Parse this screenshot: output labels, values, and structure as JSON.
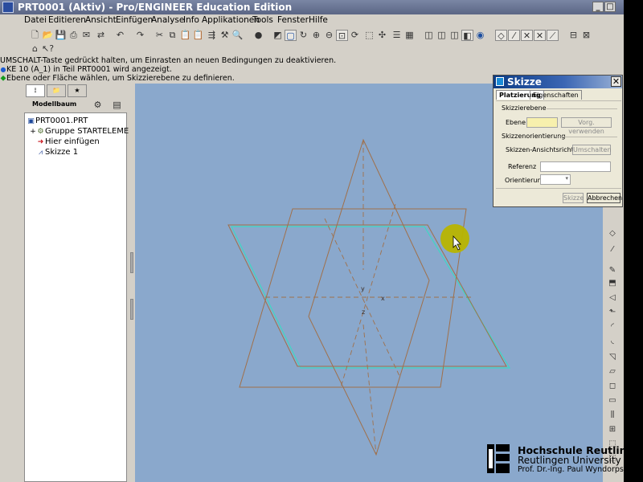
{
  "window": {
    "title": "PRT0001 (Aktiv) - Pro/ENGINEER Education Edition",
    "minimize_glyph": "_",
    "maximize_glyph": "□",
    "close_glyph": "✕"
  },
  "menu": [
    "Datei",
    "Editieren",
    "Ansicht",
    "Einfügen",
    "Analyse",
    "Info",
    "Applikationen",
    "Tools",
    "Fenster",
    "Hilfe"
  ],
  "messages": [
    "UMSCHALT-Taste gedrückt halten, um Einrasten an neuen Bedingungen zu deaktivieren.",
    "KE 10 (A_1) in Teil PRT0001 wird angezeigt.",
    "Ebene oder Fläche wählen, um Skizzierebene zu definieren."
  ],
  "model_tree": {
    "label": "Modellbaum",
    "items": [
      {
        "label": "PRT0001.PRT",
        "icon": "part-icon"
      },
      {
        "label": "Gruppe STARTELEMENT",
        "icon": "group-icon"
      },
      {
        "label": "Hier einfügen",
        "icon": "insert-arrow-icon"
      },
      {
        "label": "Skizze 1",
        "icon": "sketch-icon"
      }
    ]
  },
  "graphics": {
    "background": "#8aa8cc",
    "datum_color": "#a0704a",
    "highlight_color": "#3fd7c4",
    "axis_labels": {
      "y": "y",
      "x": "x",
      "z": "z"
    },
    "cursor_highlight_color": "#b8b400"
  },
  "dialog": {
    "title": "Skizze",
    "tabs": [
      "Platzierung",
      "Eigenschaften"
    ],
    "section_plane": "Skizzierebene",
    "plane_label": "Ebene",
    "plane_value": "",
    "use_previous": "Vorg. verwenden",
    "section_orientation": "Skizzenorientierung",
    "view_direction_label": "Skizzen-Ansichtsrichtung",
    "flip_button": "Umschalten",
    "reference_label": "Referenz",
    "reference_value": "",
    "orientation_label": "Orientierung",
    "orientation_value": "",
    "sketch_button": "Skizze",
    "cancel_button": "Abbrechen"
  },
  "logo": {
    "line1": "Hochschule Reutlingen",
    "line2": "Reutlingen University",
    "line3": "Prof. Dr.-Ing. Paul Wyndorps"
  }
}
